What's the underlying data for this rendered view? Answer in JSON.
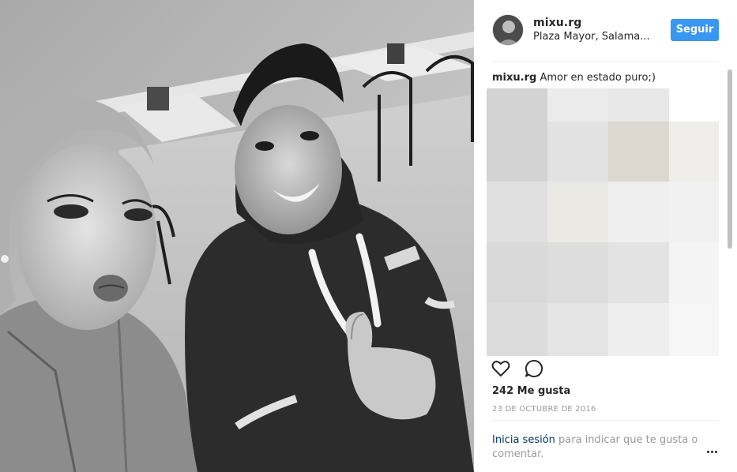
{
  "post": {
    "username": "mixu.rg",
    "location": "Plaza Mayor, Salama...",
    "follow_label": "Seguir",
    "caption_user": "mixu.rg",
    "caption_text": "Amor en estado puro;)",
    "likes": "242 Me gusta",
    "date": "23 DE OCTUBRE DE 2016",
    "login_link": "Inicia sesión",
    "login_rest": " para indicar que te gusta o comentar."
  },
  "icons": {
    "like": "heart-icon",
    "comment": "comment-icon",
    "more": "more-options-icon"
  },
  "colors": {
    "follow_button": "#3897f0",
    "link": "#003569",
    "muted": "#999999",
    "text": "#262626"
  },
  "blurred_region": [
    [
      "#d3d3d3",
      "#ececec",
      "#e8e8e8",
      "#ffffff"
    ],
    [
      "#d3d3d3",
      "#e2e2e2",
      "#dcd8cf",
      "#efeeeb"
    ],
    [
      "#e0e0e0",
      "#ebe9e3",
      "#efefef",
      "#f1f1f1"
    ],
    [
      "#d9d9d9",
      "#dddddd",
      "#e3e3e3",
      "#f4f4f4"
    ],
    [
      "#dcdcdc",
      "#e4e4e4",
      "#eeeeee",
      "#f6f6f6"
    ]
  ]
}
